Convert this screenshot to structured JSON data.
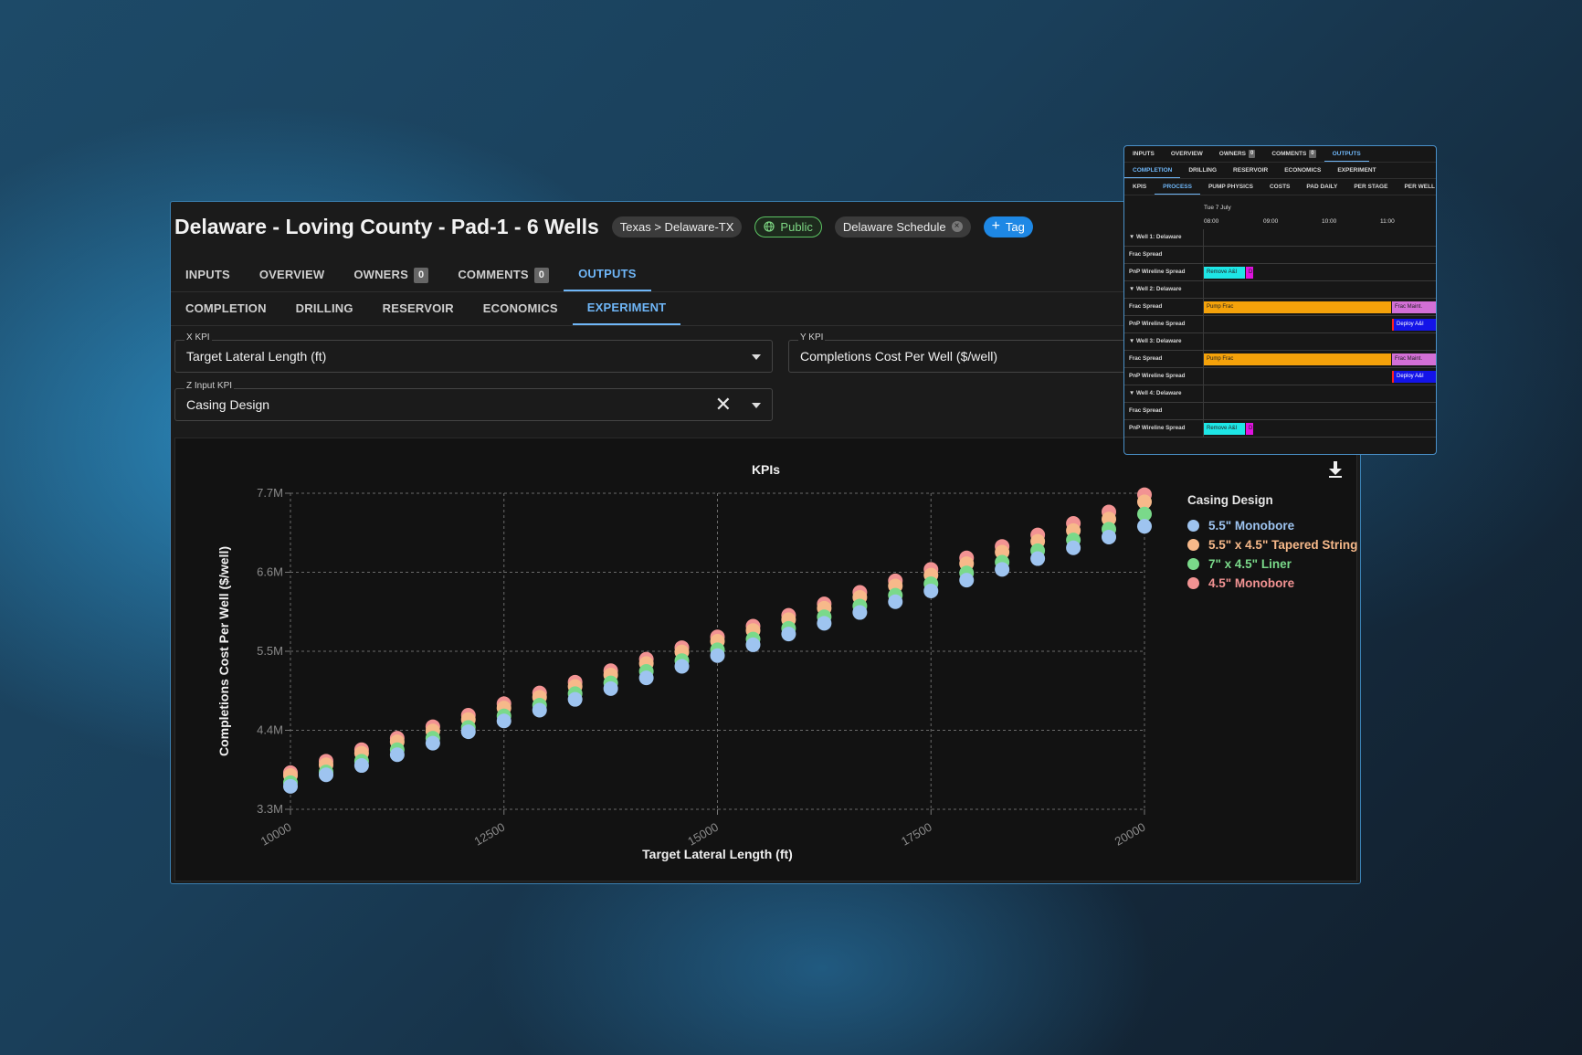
{
  "title": "Delaware - Loving County - Pad-1 - 6 Wells",
  "chips": {
    "location": "Texas > Delaware-TX",
    "visibility": "Public",
    "schedule": "Delaware Schedule",
    "add_tag": "Tag"
  },
  "main_tabs": [
    {
      "label": "INPUTS"
    },
    {
      "label": "OVERVIEW"
    },
    {
      "label": "OWNERS",
      "badge": "0"
    },
    {
      "label": "COMMENTS",
      "badge": "0"
    },
    {
      "label": "OUTPUTS",
      "active": true
    }
  ],
  "sub_tabs": [
    {
      "label": "COMPLETION"
    },
    {
      "label": "DRILLING"
    },
    {
      "label": "RESERVOIR"
    },
    {
      "label": "ECONOMICS"
    },
    {
      "label": "EXPERIMENT",
      "active": true
    }
  ],
  "fields": {
    "x_kpi": {
      "label": "X KPI",
      "value": "Target Lateral Length (ft)"
    },
    "y_kpi": {
      "label": "Y KPI",
      "value": "Completions Cost Per Well ($/well)"
    },
    "z_kpi": {
      "label": "Z Input KPI",
      "value": "Casing Design"
    }
  },
  "chart_data": {
    "type": "scatter",
    "title": "KPIs",
    "xlabel": "Target Lateral Length (ft)",
    "ylabel": "Completions Cost Per Well ($/well)",
    "xlim": [
      10000,
      20000
    ],
    "ylim": [
      3.3,
      7.7
    ],
    "x_ticks": [
      "10000",
      "12500",
      "15000",
      "17500",
      "20000"
    ],
    "y_ticks": [
      "3.3M",
      "4.4M",
      "5.5M",
      "6.6M",
      "7.7M"
    ],
    "grid": true,
    "legend_title": "Casing Design",
    "legend_position": "right",
    "x": [
      10000,
      10417,
      10833,
      11250,
      11667,
      12083,
      12500,
      12917,
      13333,
      13750,
      14167,
      14583,
      15000,
      15417,
      15833,
      16250,
      16667,
      17083,
      17500,
      17917,
      18333,
      18750,
      19167,
      19583,
      20000
    ],
    "series": [
      {
        "name": "5.5\" Monobore",
        "color": "#9ec4f0",
        "values": [
          3.62,
          3.78,
          3.91,
          4.06,
          4.22,
          4.38,
          4.53,
          4.68,
          4.83,
          4.98,
          5.13,
          5.29,
          5.44,
          5.59,
          5.74,
          5.89,
          6.04,
          6.19,
          6.34,
          6.49,
          6.64,
          6.79,
          6.94,
          7.09,
          7.24
        ]
      },
      {
        "name": "5.5\" x 4.5\" Tapered String",
        "color": "#f7b98a",
        "values": [
          3.77,
          3.92,
          4.08,
          4.24,
          4.39,
          4.55,
          4.71,
          4.86,
          5.01,
          5.17,
          5.33,
          5.49,
          5.64,
          5.79,
          5.94,
          6.1,
          6.25,
          6.41,
          6.56,
          6.72,
          6.88,
          7.03,
          7.18,
          7.34,
          7.58
        ]
      },
      {
        "name": "7\" x 4.5\" Liner",
        "color": "#7ad98a",
        "values": [
          3.67,
          3.82,
          3.97,
          4.13,
          4.29,
          4.44,
          4.6,
          4.75,
          4.91,
          5.06,
          5.22,
          5.37,
          5.52,
          5.67,
          5.82,
          5.98,
          6.13,
          6.28,
          6.44,
          6.59,
          6.74,
          6.9,
          7.05,
          7.2,
          7.41
        ]
      },
      {
        "name": "4.5\" Monobore",
        "color": "#f29393",
        "values": [
          3.81,
          3.97,
          4.13,
          4.29,
          4.45,
          4.61,
          4.77,
          4.92,
          5.07,
          5.23,
          5.39,
          5.55,
          5.7,
          5.85,
          6.0,
          6.16,
          6.32,
          6.48,
          6.64,
          6.8,
          6.96,
          7.12,
          7.28,
          7.44,
          7.68
        ]
      }
    ]
  },
  "inset": {
    "tabs": [
      {
        "label": "INPUTS"
      },
      {
        "label": "OVERVIEW"
      },
      {
        "label": "OWNERS",
        "badge": "0"
      },
      {
        "label": "COMMENTS",
        "badge": "0"
      },
      {
        "label": "OUTPUTS",
        "active": true
      }
    ],
    "sub_tabs": [
      {
        "label": "COMPLETION",
        "active": true
      },
      {
        "label": "DRILLING"
      },
      {
        "label": "RESERVOIR"
      },
      {
        "label": "ECONOMICS"
      },
      {
        "label": "EXPERIMENT"
      }
    ],
    "sub_sub_tabs": [
      {
        "label": "KPIS"
      },
      {
        "label": "PROCESS",
        "active": true
      },
      {
        "label": "PUMP PHYSICS"
      },
      {
        "label": "COSTS"
      },
      {
        "label": "PAD DAILY"
      },
      {
        "label": "PER STAGE"
      },
      {
        "label": "PER WELL"
      }
    ],
    "date": "Tue 7 July",
    "times": [
      "08:00",
      "09:00",
      "10:00",
      "11:00"
    ],
    "rows": [
      {
        "label": "▼ Well 1: Delaware"
      },
      {
        "label": "Frac Spread"
      },
      {
        "label": "PnP Wireline Spread",
        "bars": [
          {
            "text": "Remove A&I",
            "color": "#1ee6e6"
          },
          {
            "text": "D",
            "color": "#e012e0"
          }
        ]
      },
      {
        "label": "▼ Well 2: Delaware"
      },
      {
        "label": "Frac Spread",
        "bars": [
          {
            "text": "Pump Frac",
            "color": "#f5a20a"
          },
          {
            "text": "Frac Maint.",
            "color": "#d36fd6"
          }
        ]
      },
      {
        "label": "PnP Wireline Spread",
        "bars": [
          {
            "text": "Deploy A&I",
            "color": "#1414e8"
          }
        ]
      },
      {
        "label": "▼ Well 3: Delaware"
      },
      {
        "label": "Frac Spread",
        "bars": [
          {
            "text": "Pump Frac",
            "color": "#f5a20a"
          },
          {
            "text": "Frac Maint.",
            "color": "#d36fd6"
          }
        ]
      },
      {
        "label": "PnP Wireline Spread",
        "bars": [
          {
            "text": "Deploy A&I",
            "color": "#1414e8"
          }
        ]
      },
      {
        "label": "▼ Well 4: Delaware"
      },
      {
        "label": "Frac Spread"
      },
      {
        "label": "PnP Wireline Spread",
        "bars": [
          {
            "text": "Remove A&I",
            "color": "#1ee6e6"
          },
          {
            "text": "D",
            "color": "#e012e0"
          }
        ]
      }
    ]
  },
  "colors": {
    "accent": "#6fb6f7",
    "frame": "#3a7fb0",
    "tag_button": "#1e88e5"
  }
}
